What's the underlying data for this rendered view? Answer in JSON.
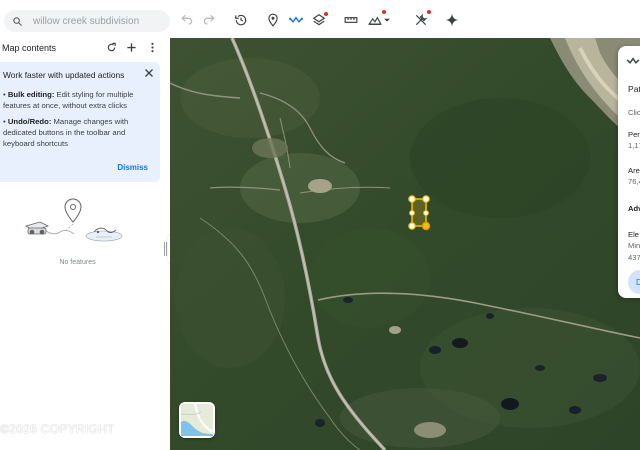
{
  "search": {
    "placeholder": "willow creek subdivision"
  },
  "toolbar": {
    "undo": "undo-icon",
    "redo": "redo-icon",
    "history": "history-icon",
    "add_placemark": "placemark-icon",
    "draw_path": "path-icon",
    "layers": "layers-icon",
    "measure": "ruler-icon",
    "terrain": "terrain-icon",
    "tools": "tools-icon",
    "ai": "sparkle-icon",
    "notify_color": "#d93025"
  },
  "panel": {
    "title": "Map contents",
    "tip": {
      "title": "Work faster with updated actions",
      "bulk_label": "Bulk editing:",
      "bulk_text": "Edit styling for multiple features at once, without extra clicks",
      "undo_label": "Undo/Redo:",
      "undo_text": "Manage changes with dedicated buttons in the toolbar and keyboard shortcuts",
      "dismiss": "Dismiss"
    },
    "empty": "No features"
  },
  "card": {
    "title": "Pat",
    "hint": "Clic",
    "perimeter_label": "Per",
    "perimeter_value": "1,17",
    "area_label": "Are",
    "area_value": "76,4",
    "advanced_label": "Adv",
    "elev_label": "Ele",
    "elev_min": "Min",
    "elev_value": "437",
    "button": "D"
  },
  "copyright": "©2026 COPYRIGHT",
  "colors": {
    "accent": "#1a73e8",
    "tip_bg": "#e8f0fe",
    "shape": "#fbbc04"
  }
}
